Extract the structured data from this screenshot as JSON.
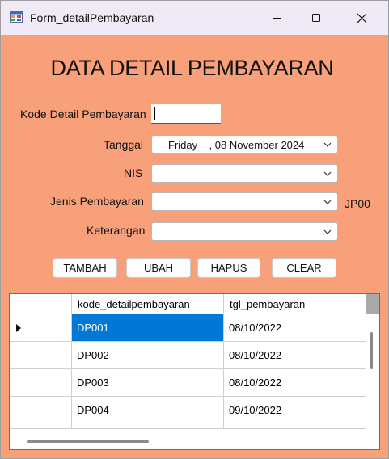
{
  "window": {
    "title": "Form_detailPembayaran",
    "icon": "winforms-app-icon"
  },
  "form": {
    "heading": "DATA DETAIL PEMBAYARAN",
    "kode_label": "Kode Detail Pembayaran",
    "kode_value": "",
    "tanggal_label": "Tanggal",
    "tanggal_value": "Friday    , 08 November 2024",
    "nis_label": "NIS",
    "nis_value": "",
    "jenis_label": "Jenis Pembayaran",
    "jenis_value": "",
    "jenis_side_text": "JP00",
    "keterangan_label": "Keterangan",
    "keterangan_value": ""
  },
  "buttons": {
    "tambah": "TAMBAH",
    "ubah": "UBAH",
    "hapus": "HAPUS",
    "clear": "CLEAR"
  },
  "table": {
    "columns": [
      "kode_detailpembayaran",
      "tgl_pembayaran"
    ],
    "rows": [
      {
        "kode": "DP001",
        "tgl": "08/10/2022"
      },
      {
        "kode": "DP002",
        "tgl": "08/10/2022"
      },
      {
        "kode": "DP003",
        "tgl": "08/10/2022"
      },
      {
        "kode": "DP004",
        "tgl": "09/10/2022"
      }
    ]
  },
  "colors": {
    "form_background": "#f7a07a",
    "titlebar": "#efeaf5",
    "selection": "#0078d7",
    "focus_underline": "#1f63b8"
  }
}
